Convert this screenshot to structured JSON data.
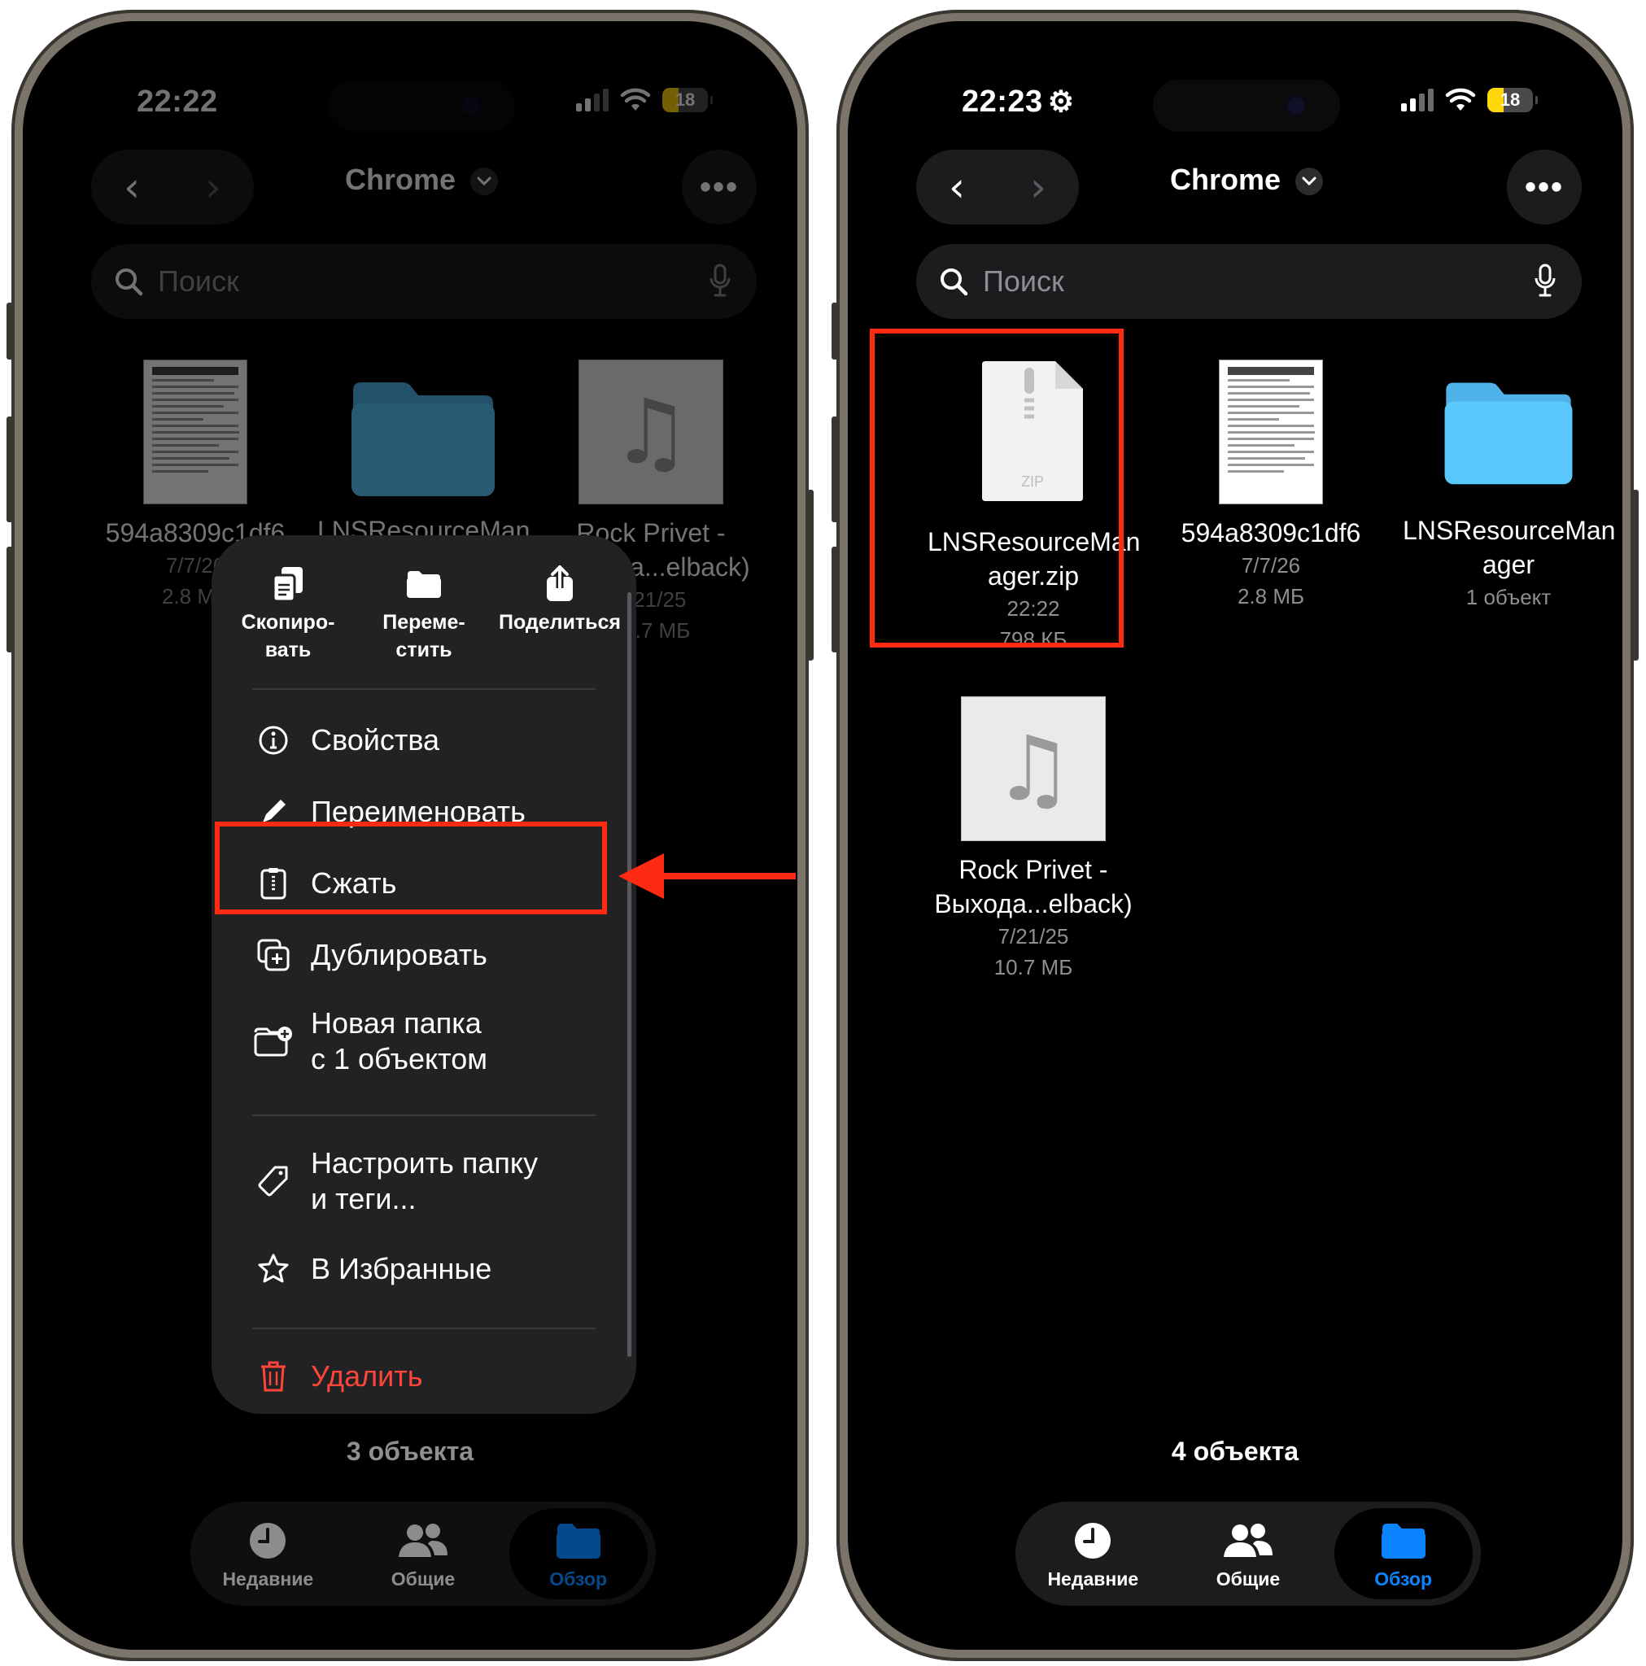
{
  "colors": {
    "accent": "#0a84ff",
    "folder": "#5ac8fa",
    "danger": "#ff453a",
    "highlight": "#ff2a12",
    "battery": "#ffd60a"
  },
  "left": {
    "status": {
      "time": "22:22",
      "battery": "18"
    },
    "header": {
      "title": "Chrome"
    },
    "search": {
      "placeholder": "Поиск"
    },
    "files": [
      {
        "name": "594a8309c1df6",
        "date": "7/7/26",
        "size": "2.8 МБ",
        "icon": "document-thumbnail"
      },
      {
        "name": "LNSResourceMan",
        "icon": "folder-icon"
      },
      {
        "name": "Rock Privet -",
        "name2": "Выхода...elback)",
        "date": "7/21/25",
        "size": "10.7 МБ",
        "icon": "music-icon"
      }
    ],
    "menu": {
      "quick": [
        {
          "label1": "Скопиро-",
          "label2": "вать",
          "icon": "copy-icon"
        },
        {
          "label1": "Переме-",
          "label2": "стить",
          "icon": "move-folder-icon"
        },
        {
          "label1": "Поделиться",
          "label2": "",
          "icon": "share-icon"
        }
      ],
      "items": [
        {
          "label": "Свойства",
          "icon": "info-icon"
        },
        {
          "label": "Переименовать",
          "icon": "pencil-icon"
        },
        {
          "label": "Сжать",
          "icon": "archive-icon"
        },
        {
          "label": "Дублировать",
          "icon": "duplicate-icon"
        },
        {
          "label": "Новая папка",
          "label2": "с 1 объектом",
          "icon": "new-folder-icon"
        },
        {
          "label": "Настроить папку",
          "label2": "и теги...",
          "icon": "tag-icon"
        },
        {
          "label": "В Избранные",
          "icon": "star-icon"
        },
        {
          "label": "Удалить",
          "icon": "trash-icon"
        }
      ]
    },
    "count": "3 объекта",
    "tabs": [
      {
        "label": "Недавние"
      },
      {
        "label": "Общие"
      },
      {
        "label": "Обзор"
      }
    ]
  },
  "right": {
    "status": {
      "time": "22:23",
      "battery": "18"
    },
    "header": {
      "title": "Chrome"
    },
    "search": {
      "placeholder": "Поиск"
    },
    "files": [
      {
        "name": "LNSResourceMan",
        "name2": "ager.zip",
        "date": "22:22",
        "size": "798 КБ",
        "badge": "ZIP",
        "icon": "zip-icon"
      },
      {
        "name": "594a8309c1df6",
        "date": "7/7/26",
        "size": "2.8 МБ",
        "icon": "document-thumbnail"
      },
      {
        "name": "LNSResourceMan",
        "name2": "ager",
        "size": "1 объект",
        "icon": "folder-icon"
      },
      {
        "name": "Rock Privet -",
        "name2": "Выхода...elback)",
        "date": "7/21/25",
        "size": "10.7 МБ",
        "icon": "music-icon"
      }
    ],
    "count": "4 объекта",
    "tabs": [
      {
        "label": "Недавние"
      },
      {
        "label": "Общие"
      },
      {
        "label": "Обзор"
      }
    ]
  }
}
